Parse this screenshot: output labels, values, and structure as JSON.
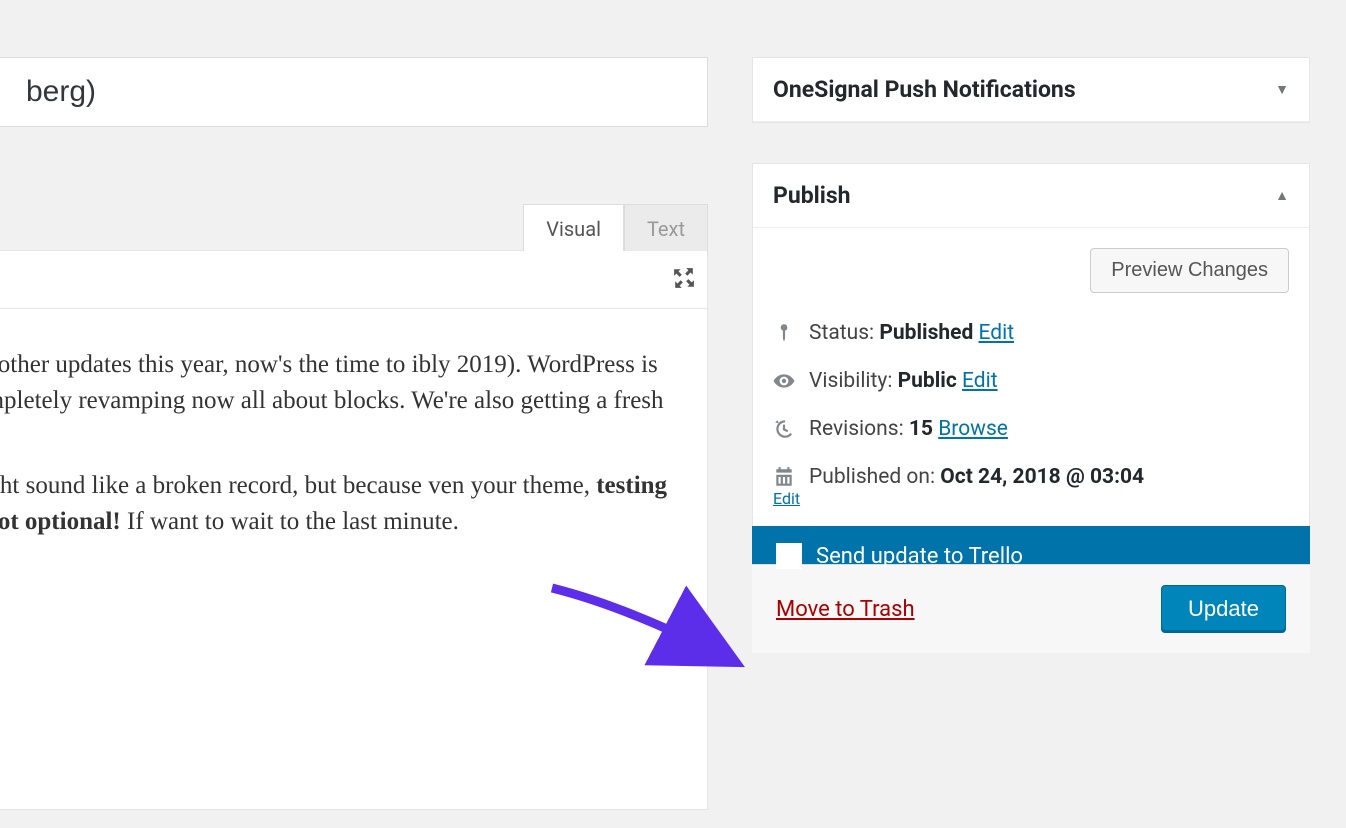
{
  "title_fragment": "berg)",
  "editor": {
    "tabs": {
      "visual": "Visual",
      "text": "Text"
    },
    "p1": " the other updates this year, now's the time to ibly 2019). WordPress is completely revamping now all about blocks. We're also getting a fresh ",
    "p2_a": "might sound like a broken record, but because ven your theme, ",
    "p2_b": "testing is not optional!",
    "p2_c": " If want to wait to the last minute."
  },
  "sidebar": {
    "onesignal_title": "OneSignal Push Notifications",
    "publish_title": "Publish",
    "preview_btn": "Preview Changes",
    "status_label": "Status: ",
    "status_value": "Published",
    "status_edit": "Edit",
    "visibility_label": "Visibility: ",
    "visibility_value": "Public",
    "visibility_edit": "Edit",
    "revisions_label": "Revisions: ",
    "revisions_value": "15",
    "revisions_browse": "Browse",
    "published_label": "Published on: ",
    "published_value": "Oct 24, 2018 @ 03:04",
    "published_edit": "Edit",
    "trello_label": "Send update to Trello",
    "trash": "Move to Trash",
    "update": "Update"
  }
}
